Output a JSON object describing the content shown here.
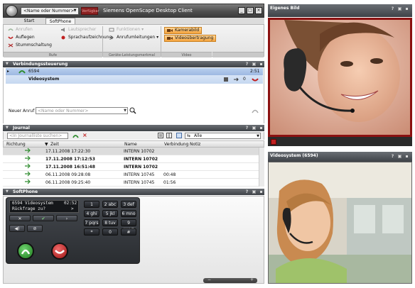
{
  "titlebar": {
    "name_placeholder": "<Name oder Nummer>",
    "status_label": "Verfügbar",
    "app_title": "Siemens OpenScape Desktop Client"
  },
  "tabs": [
    "Start",
    "SoftPhone"
  ],
  "ribbon": {
    "anrufen": "Anrufen",
    "auflegen": "Auflegen",
    "stummschaltung": "Stummschaltung",
    "lautsprecher": "Lautsprecher",
    "sprachaufzeichnung": "Sprachaufzeichnung",
    "funktionen": "Funktionen",
    "anrufumleitungen": "Anrufumleitungen",
    "kamerabild": "Kamerabild",
    "videouebertragung": "Videoübertragung",
    "group_rufe": "Rufe",
    "group_geraete": "Geräte-Leistungsmerkmal",
    "group_video": "Video"
  },
  "call_control": {
    "header": "Verbindungssteuerung",
    "number": "6594",
    "duration": "2:51",
    "party": "Videosystem",
    "counter": "0",
    "new_call_label": "Neuer Anruf",
    "new_call_placeholder": "<Name oder Nummer>"
  },
  "journal": {
    "header": "Journal",
    "search_placeholder": "<In Journalliste suchen>",
    "filter_value": "Alle",
    "columns": [
      "Richtung",
      "Zeit",
      "Name",
      "Verbindung",
      "Notiz"
    ],
    "rows": [
      {
        "time": "17.11.2008 17:22:30",
        "name": "INTERN 10702",
        "duration": "",
        "bold": false,
        "selected": true
      },
      {
        "time": "17.11.2008 17:12:53",
        "name": "INTERN 10702",
        "duration": "",
        "bold": true,
        "selected": false
      },
      {
        "time": "17.11.2008 16:51:48",
        "name": "INTERN 10702",
        "duration": "",
        "bold": true,
        "selected": false
      },
      {
        "time": "06.11.2008 09:28:08",
        "name": "INTERN 10745",
        "duration": "00:48",
        "bold": false,
        "selected": false
      },
      {
        "time": "06.11.2008 09:25:40",
        "name": "INTERN 10745",
        "duration": "01:56",
        "bold": false,
        "selected": false
      }
    ]
  },
  "softphone": {
    "header": "SoftPhone",
    "lcd_line1": "6594 Videosystem",
    "lcd_time": "02:52",
    "lcd_line2": "Rückfrage zu?",
    "lcd_arrow": ">",
    "keys": [
      "1",
      "2 abc",
      "3 def",
      "4 ghi",
      "5 jkl",
      "6 mno",
      "7 pqrs",
      "8 tuv",
      "9 wxyz",
      "*",
      "0",
      "#"
    ]
  },
  "video": {
    "own_header": "Eigenes Bild",
    "remote_header": "Videosystem (6594)"
  },
  "colors": {
    "accent_red": "#8b1111",
    "header_dark": "#4a4e54",
    "call_blue": "#b9cfee",
    "orange_active": "#f5a33b"
  }
}
